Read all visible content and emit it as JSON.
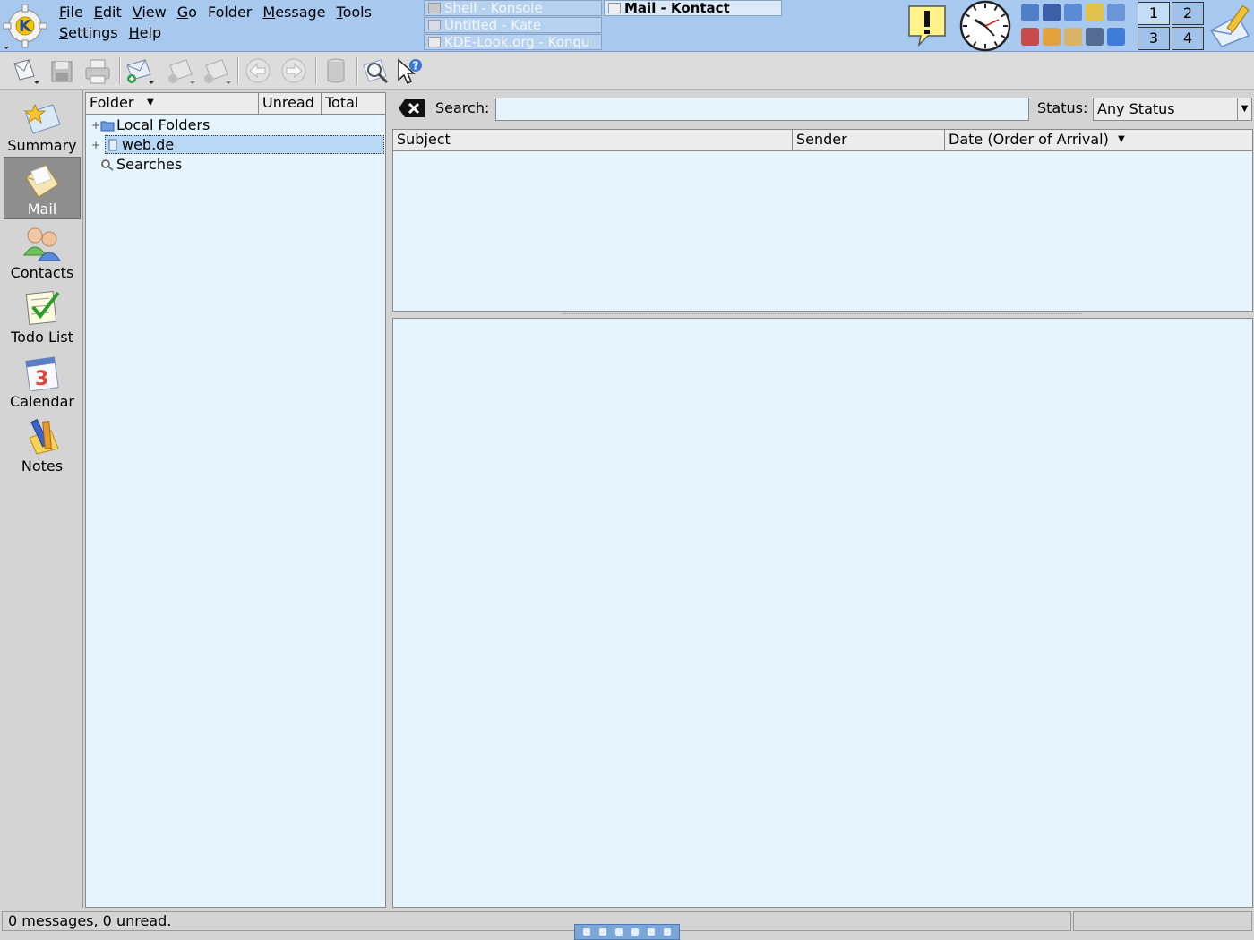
{
  "menubar": {
    "row1": [
      {
        "label": "File",
        "ul": "F",
        "rest": "ile"
      },
      {
        "label": "Edit",
        "ul": "E",
        "rest": "dit"
      },
      {
        "label": "View",
        "ul": "V",
        "rest": "iew"
      },
      {
        "label": "Go",
        "ul": "G",
        "rest": "o"
      },
      {
        "label": "Folder",
        "ul": "",
        "rest": "Folder"
      },
      {
        "label": "Message",
        "ul": "M",
        "rest": "essage"
      },
      {
        "label": "Tools",
        "ul": "T",
        "rest": "ools"
      }
    ],
    "row2": [
      {
        "label": "Settings",
        "ul": "S",
        "rest": "ettings"
      },
      {
        "label": "Help",
        "ul": "H",
        "rest": "elp"
      }
    ]
  },
  "taskbar": {
    "tasks": [
      {
        "label": "Shell - Konsole",
        "active": false
      },
      {
        "label": "Untitled - Kate",
        "active": false
      },
      {
        "label": "KDE-Look.org - Konqu",
        "active": false
      },
      {
        "label": "Mail - Kontact",
        "active": true
      }
    ]
  },
  "pager": {
    "desktops": [
      "1",
      "2",
      "3",
      "4"
    ],
    "current": "1"
  },
  "sidebar": {
    "items": [
      {
        "label": "Summary",
        "icon": "summary-icon",
        "selected": false
      },
      {
        "label": "Mail",
        "icon": "mail-icon",
        "selected": true
      },
      {
        "label": "Contacts",
        "icon": "contacts-icon",
        "selected": false
      },
      {
        "label": "Todo List",
        "icon": "todo-icon",
        "selected": false
      },
      {
        "label": "Calendar",
        "icon": "calendar-icon",
        "selected": false
      },
      {
        "label": "Notes",
        "icon": "notes-icon",
        "selected": false
      }
    ],
    "calendar_day": "3"
  },
  "folders": {
    "headers": {
      "folder": "Folder",
      "unread": "Unread",
      "total": "Total"
    },
    "items": [
      {
        "label": "Local Folders",
        "icon": "folder-icon",
        "expandable": true,
        "selected": false
      },
      {
        "label": "web.de",
        "icon": "imap-account-icon",
        "expandable": true,
        "selected": true
      },
      {
        "label": "Searches",
        "icon": "search-folder-icon",
        "expandable": false,
        "selected": false
      }
    ]
  },
  "search": {
    "label": "Search:",
    "label_ul": "e",
    "value": "",
    "status_label": "Status:",
    "status_value": "Any Status"
  },
  "messages": {
    "headers": {
      "subject": "Subject",
      "sender": "Sender",
      "date": "Date (Order of Arrival)"
    },
    "rows": []
  },
  "statusbar": {
    "message": "0 messages, 0 unread."
  },
  "colors": {
    "panel": "#a7c8ef",
    "list_bg": "#e6f5fd",
    "selection": "#b9d8f4",
    "chrome": "#d4d4d4"
  }
}
